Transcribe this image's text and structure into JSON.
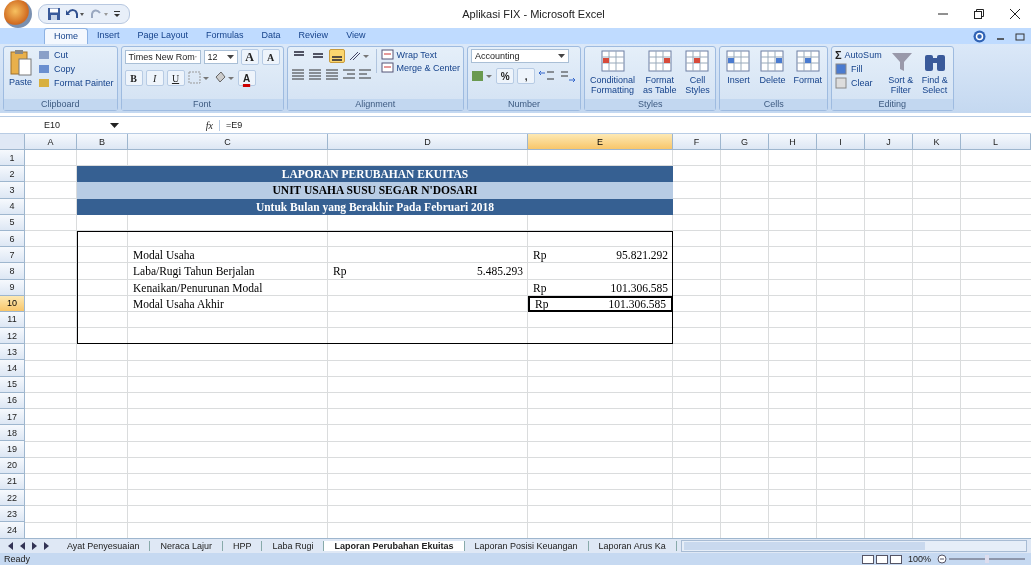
{
  "window": {
    "title": "Aplikasi FIX - Microsoft Excel"
  },
  "ribbon_tabs": [
    {
      "label": "Home",
      "selected": true
    },
    {
      "label": "Insert",
      "selected": false
    },
    {
      "label": "Page Layout",
      "selected": false
    },
    {
      "label": "Formulas",
      "selected": false
    },
    {
      "label": "Data",
      "selected": false
    },
    {
      "label": "Review",
      "selected": false
    },
    {
      "label": "View",
      "selected": false
    }
  ],
  "ribbon_groups": [
    {
      "kind": "clipboard",
      "name": "Clipboard",
      "large": "Paste",
      "small": [
        "Cut",
        "Copy",
        "Format Painter"
      ]
    },
    {
      "kind": "font",
      "name": "Font",
      "font_name": "Times New Rom",
      "font_size": "12",
      "grow": "A",
      "shrink": "A",
      "styles": [
        "B",
        "I",
        "U"
      ],
      "font_color": "A"
    },
    {
      "kind": "alignment",
      "name": "Alignment",
      "vertical_align": [
        {
          "selected": false
        },
        {
          "selected": false
        },
        {
          "selected": true
        }
      ],
      "buttons": [
        "Wrap Text",
        "Merge & Center"
      ]
    },
    {
      "kind": "number",
      "name": "Number",
      "format": "Accounting",
      "symbols": [
        "%",
        ","
      ]
    },
    {
      "kind": "styles",
      "name": "Styles",
      "large": [
        {
          "top": "Conditional",
          "bottom": "Formatting"
        },
        {
          "top": "Format",
          "bottom": "as Table"
        },
        {
          "top": "Cell",
          "bottom": "Styles"
        }
      ]
    },
    {
      "kind": "cells",
      "name": "Cells",
      "large": [
        {
          "top": "Insert"
        },
        {
          "top": "Delete"
        },
        {
          "top": "Format"
        }
      ]
    },
    {
      "kind": "editing",
      "name": "Editing",
      "small": [
        {
          "glyph": "Σ",
          "label": "AutoSum"
        },
        {
          "label": "Fill"
        },
        {
          "label": "Clear"
        }
      ],
      "large": [
        {
          "top": "Sort &",
          "bottom": "Filter"
        },
        {
          "top": "Find &",
          "bottom": "Select"
        }
      ]
    }
  ],
  "formula_bar": {
    "name_box": "E10",
    "fx": "fx",
    "formula": "=E9"
  },
  "columns": [
    {
      "label": "A",
      "selected": false
    },
    {
      "label": "B",
      "selected": false
    },
    {
      "label": "C",
      "selected": false
    },
    {
      "label": "D",
      "selected": false
    },
    {
      "label": "E",
      "selected": true
    },
    {
      "label": "F",
      "selected": false
    },
    {
      "label": "G",
      "selected": false
    },
    {
      "label": "H",
      "selected": false
    },
    {
      "label": "I",
      "selected": false
    },
    {
      "label": "J",
      "selected": false
    },
    {
      "label": "K",
      "selected": false
    },
    {
      "label": "L",
      "selected": false
    }
  ],
  "rows": [
    {
      "label": "1",
      "selected": false
    },
    {
      "label": "2",
      "selected": false
    },
    {
      "label": "3",
      "selected": false
    },
    {
      "label": "4",
      "selected": false
    },
    {
      "label": "5",
      "selected": false
    },
    {
      "label": "6",
      "selected": false
    },
    {
      "label": "7",
      "selected": false
    },
    {
      "label": "8",
      "selected": false
    },
    {
      "label": "9",
      "selected": false
    },
    {
      "label": "10",
      "selected": true
    },
    {
      "label": "11",
      "selected": false
    },
    {
      "label": "12",
      "selected": false
    },
    {
      "label": "13",
      "selected": false
    },
    {
      "label": "14",
      "selected": false
    },
    {
      "label": "15",
      "selected": false
    },
    {
      "label": "16",
      "selected": false
    },
    {
      "label": "17",
      "selected": false
    },
    {
      "label": "18",
      "selected": false
    },
    {
      "label": "19",
      "selected": false
    },
    {
      "label": "20",
      "selected": false
    },
    {
      "label": "21",
      "selected": false
    },
    {
      "label": "22",
      "selected": false
    },
    {
      "label": "23",
      "selected": false
    },
    {
      "label": "24",
      "selected": false
    }
  ],
  "report": {
    "titles": [
      {
        "text": "LAPORAN PERUBAHAN EKUITAS",
        "kind": "dark"
      },
      {
        "text": "UNIT USAHA SUSU SEGAR N'DOSARI",
        "kind": "light"
      },
      {
        "text": "Untuk Bulan yang Berakhir Pada Februari 2018",
        "kind": "dark"
      }
    ],
    "lines": [
      {
        "label": "Modal Usaha",
        "e_currency": "Rp",
        "e_amount": "95.821.292",
        "selected": false
      },
      {
        "label": "Laba/Rugi Tahun Berjalan",
        "d_currency": "Rp",
        "d_amount": "5.485.293",
        "selected": false
      },
      {
        "label": "Kenaikan/Penurunan Modal",
        "e_currency": "Rp",
        "e_amount": "101.306.585",
        "selected": false
      },
      {
        "label": "Modal Usaha Akhir",
        "e_currency": "Rp",
        "e_amount": "101.306.585",
        "selected": true
      }
    ]
  },
  "sheet_tabs": [
    {
      "label": "Ayat Penyesuaian",
      "selected": false
    },
    {
      "label": "Neraca Lajur",
      "selected": false
    },
    {
      "label": "HPP",
      "selected": false
    },
    {
      "label": "Laba Rugi",
      "selected": false
    },
    {
      "label": "Laporan Perubahan Ekuitas",
      "selected": true
    },
    {
      "label": "Laporan Posisi Keuangan",
      "selected": false
    },
    {
      "label": "Laporan Arus Ka",
      "selected": false
    }
  ],
  "status_bar": {
    "status": "Ready",
    "zoom": "100%"
  }
}
